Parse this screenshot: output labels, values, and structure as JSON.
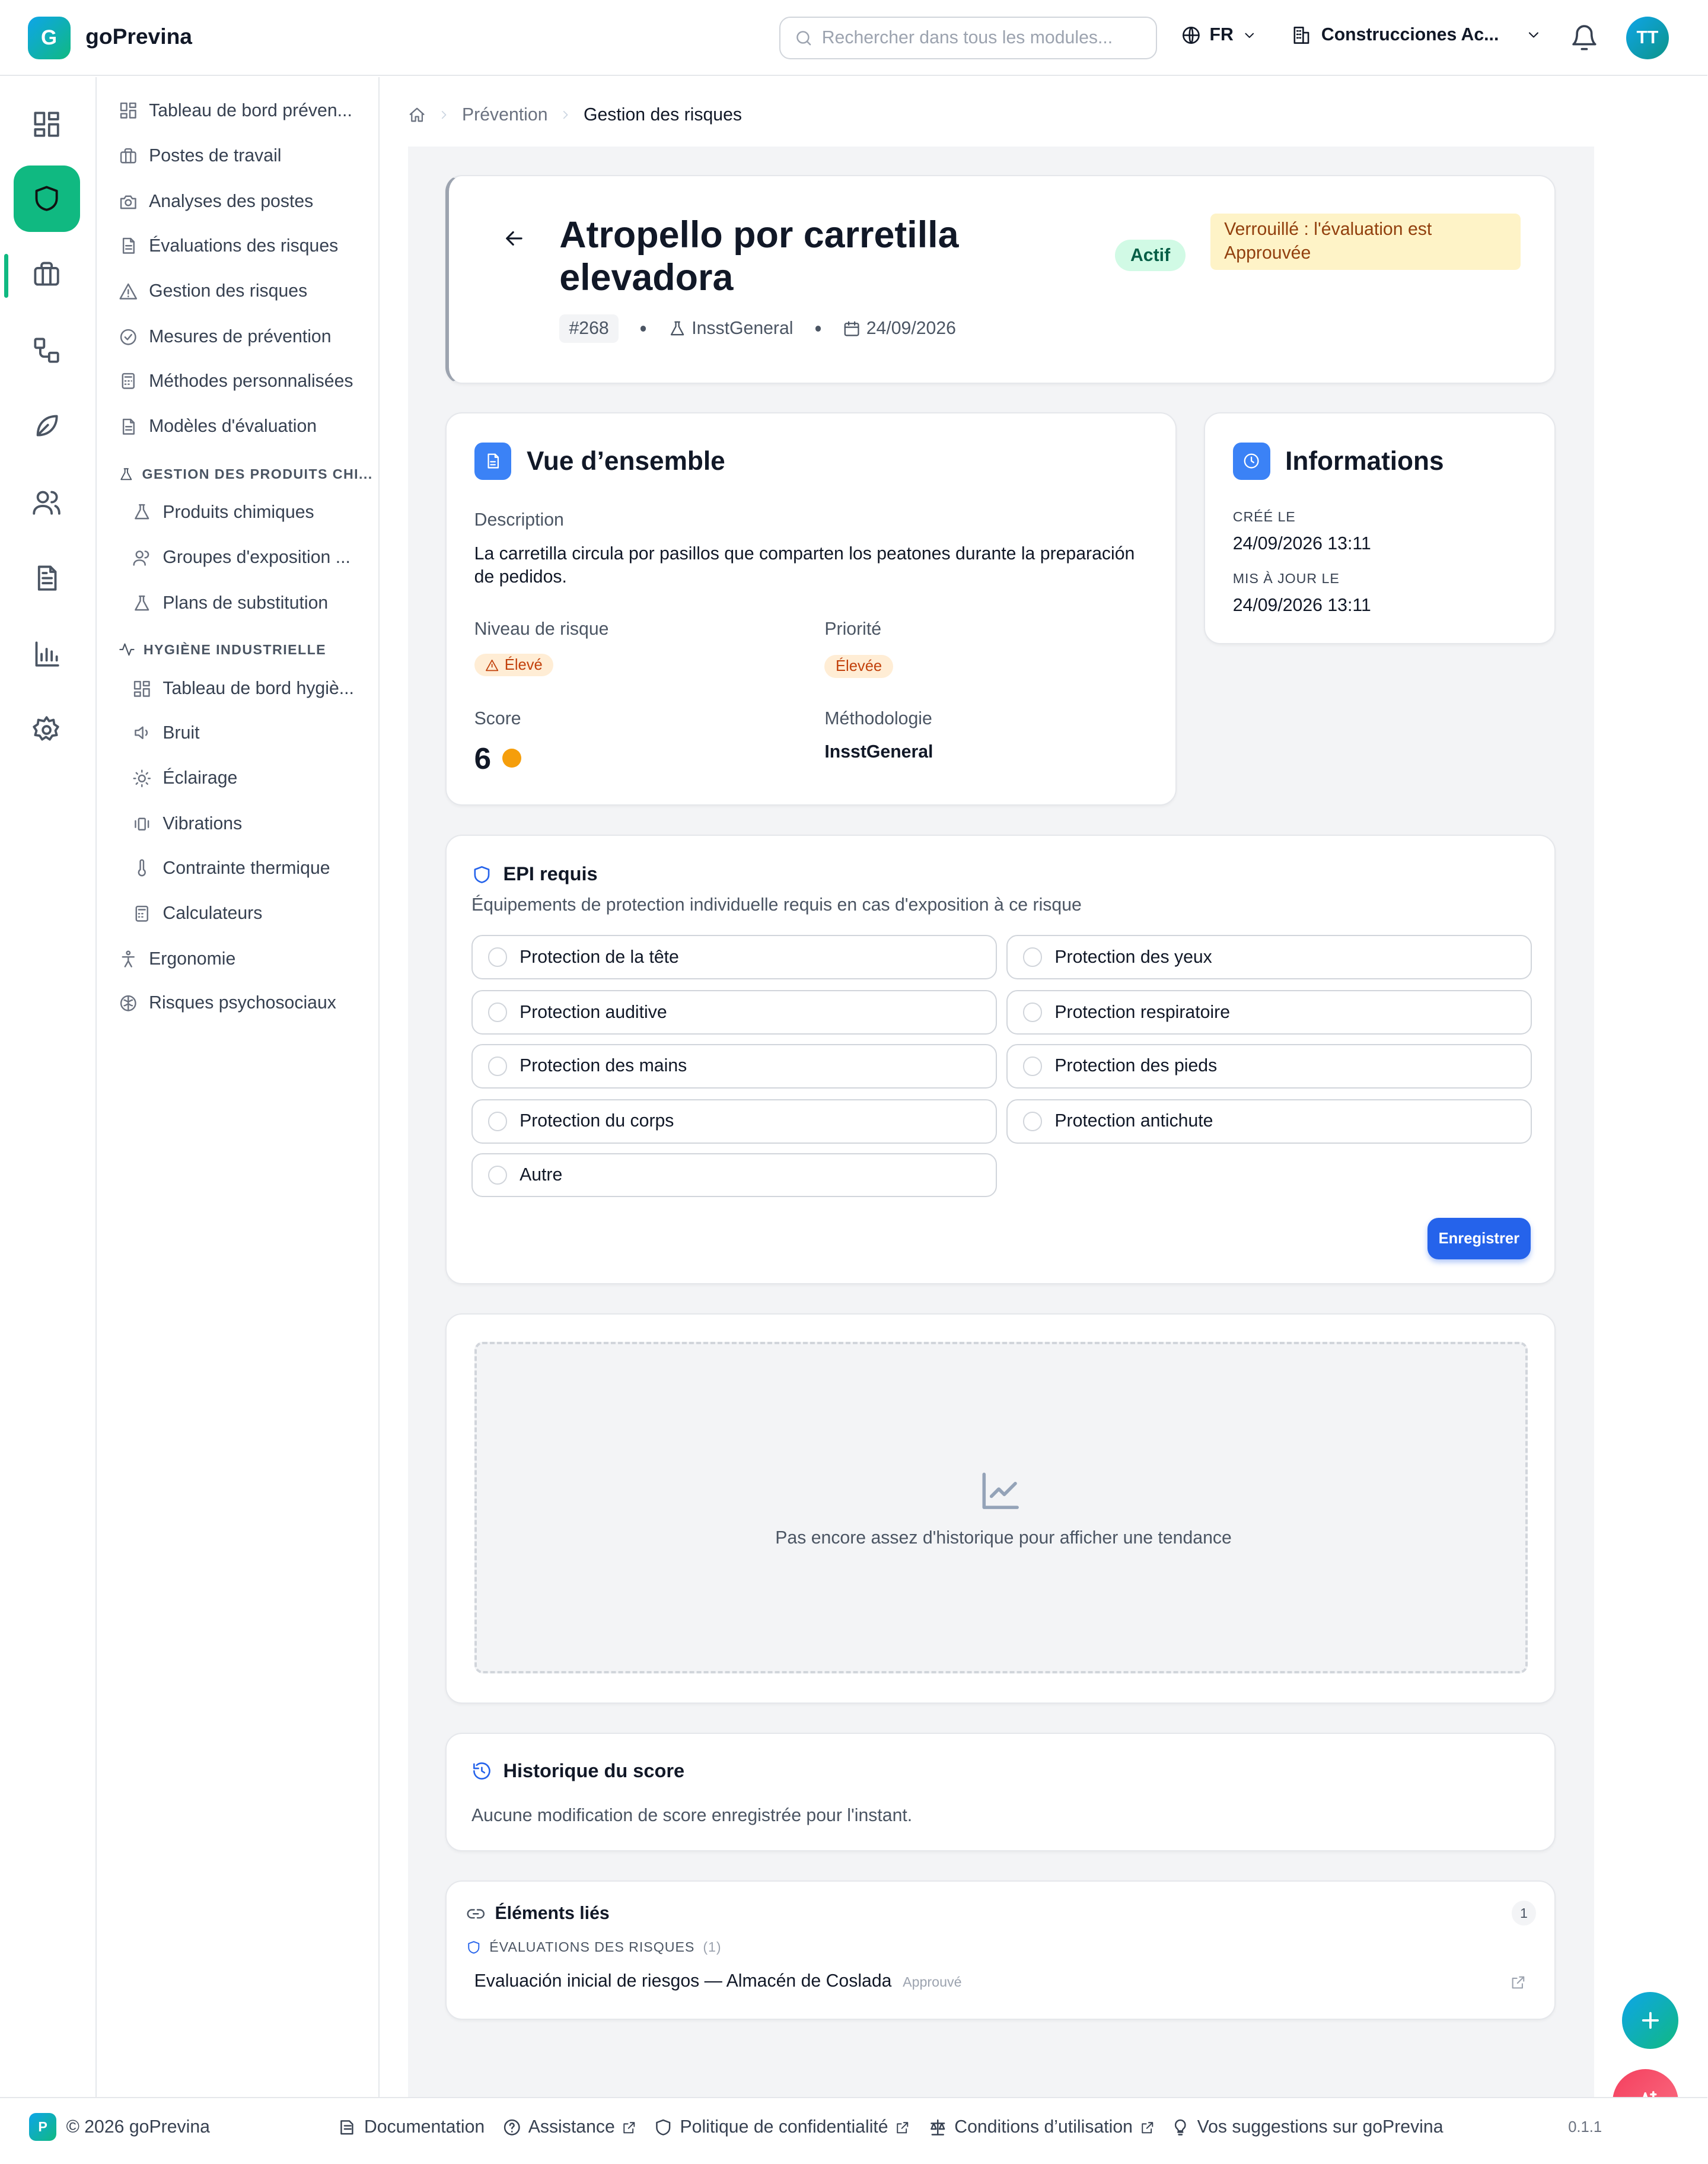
{
  "header": {
    "logo_letter": "G",
    "app_name": "goPrevina",
    "search_placeholder": "Rechercher dans tous les modules...",
    "language": "FR",
    "organization": "Construcciones Ac...",
    "user_initials": "TT"
  },
  "sidebar": {
    "items": [
      {
        "label": "Tableau de bord préven...",
        "icon": "dashboard-icon"
      },
      {
        "label": "Postes de travail",
        "icon": "briefcase-icon"
      },
      {
        "label": "Analyses des postes",
        "icon": "camera-icon"
      },
      {
        "label": "Évaluations des risques",
        "icon": "document-icon"
      },
      {
        "label": "Gestion des risques",
        "icon": "warning-icon"
      },
      {
        "label": "Mesures de prévention",
        "icon": "check-circle-icon"
      },
      {
        "label": "Méthodes personnalisées",
        "icon": "calculator-icon"
      },
      {
        "label": "Modèles d'évaluation",
        "icon": "document-icon"
      }
    ],
    "chem_section": "GESTION DES PRODUITS CHI...",
    "chem_items": [
      {
        "label": "Produits chimiques"
      },
      {
        "label": "Groupes d'exposition ..."
      },
      {
        "label": "Plans de substitution"
      }
    ],
    "hyg_section": "HYGIÈNE INDUSTRIELLE",
    "hyg_items": [
      {
        "label": "Tableau de bord hygiè..."
      },
      {
        "label": "Bruit"
      },
      {
        "label": "Éclairage"
      },
      {
        "label": "Vibrations"
      },
      {
        "label": "Contrainte thermique"
      },
      {
        "label": "Calculateurs"
      }
    ],
    "bottom_items": [
      {
        "label": "Ergonomie"
      },
      {
        "label": "Risques psychosociaux"
      }
    ]
  },
  "breadcrumb": {
    "parent": "Prévention",
    "current": "Gestion des risques"
  },
  "risk": {
    "title": "Atropello por carretilla elevadora",
    "id": "#268",
    "method": "InsstGeneral",
    "date": "24/09/2026",
    "status": "Actif",
    "lock_message": "Verrouillé : l'évaluation est Approuvée"
  },
  "overview": {
    "heading": "Vue d’ensemble",
    "description_label": "Description",
    "description": "La carretilla circula por pasillos que comparten los peatones durante la preparación de pedidos.",
    "risk_level_label": "Niveau de risque",
    "risk_level": "Élevé",
    "priority_label": "Priorité",
    "priority": "Élevée",
    "score_label": "Score",
    "score": "6",
    "score_color": "#f59e0b",
    "methodology_label": "Méthodologie",
    "methodology": "InsstGeneral"
  },
  "info": {
    "heading": "Informations",
    "created_label": "CRÉÉ LE",
    "created": "24/09/2026 13:11",
    "updated_label": "MIS À JOUR LE",
    "updated": "24/09/2026 13:11"
  },
  "epi": {
    "heading": "EPI requis",
    "subtitle": "Équipements de protection individuelle requis en cas d'exposition à ce risque",
    "options": [
      "Protection de la tête",
      "Protection des yeux",
      "Protection auditive",
      "Protection respiratoire",
      "Protection des mains",
      "Protection des pieds",
      "Protection du corps",
      "Protection antichute",
      "Autre"
    ],
    "save_label": "Enregistrer"
  },
  "trend": {
    "empty_message": "Pas encore assez d'historique pour afficher une tendance"
  },
  "history": {
    "heading": "Historique du score",
    "empty_message": "Aucune modification de score enregistrée pour l'instant."
  },
  "linked": {
    "heading": "Éléments liés",
    "count": "1",
    "group_label": "ÉVALUATIONS DES RISQUES",
    "group_count": "(1)",
    "item_title": "Evaluación inicial de riesgos — Almacén de Coslada",
    "item_status": "Approuvé"
  },
  "footer": {
    "badge": "P",
    "copyright": "© 2026 goPrevina",
    "documentation": "Documentation",
    "assistance": "Assistance",
    "privacy": "Politique de confidentialité",
    "terms": "Conditions d’utilisation",
    "suggestions": "Vos suggestions sur goPrevina",
    "version": "0.1.1"
  },
  "colors": {
    "brand": "#10b981",
    "primary": "#2563eb",
    "warning_bg": "#fef3c7",
    "active_bg": "#d1fae5"
  }
}
